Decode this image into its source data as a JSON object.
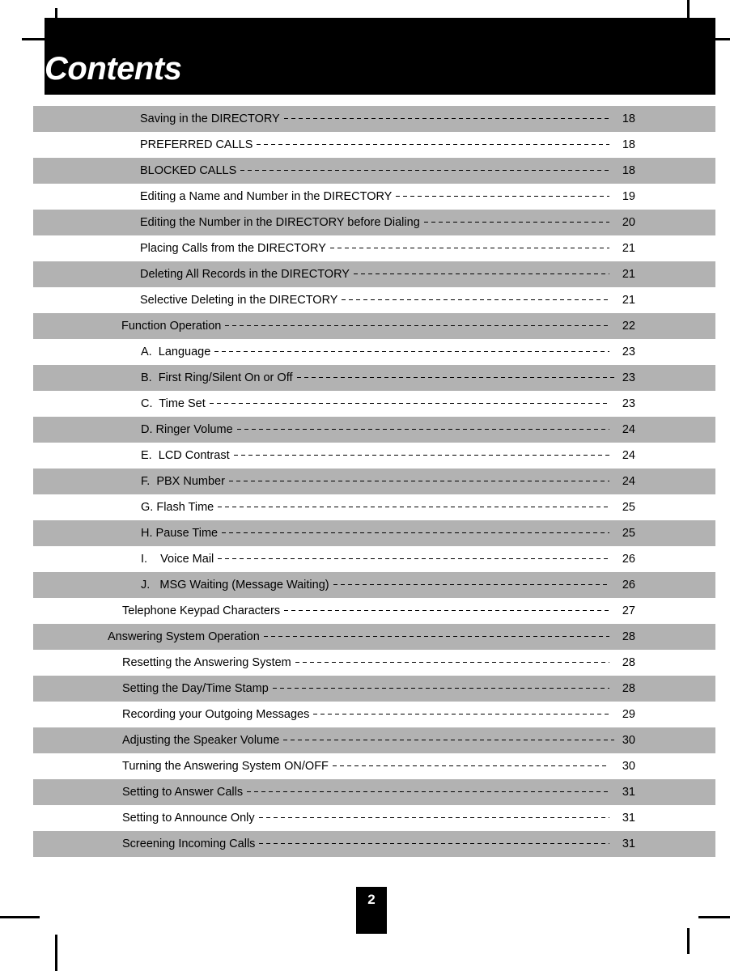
{
  "document": {
    "title": "Contents",
    "page_number": "2"
  },
  "toc": {
    "entries": [
      {
        "label": "Saving in the DIRECTORY",
        "page": "18",
        "indent": 3,
        "shaded": true,
        "tight": false
      },
      {
        "label": "PREFERRED CALLS",
        "page": "18",
        "indent": 3,
        "shaded": false,
        "tight": false
      },
      {
        "label": "BLOCKED CALLS",
        "page": "18",
        "indent": 3,
        "shaded": true,
        "tight": false
      },
      {
        "label": "Editing a Name and Number in the DIRECTORY",
        "page": "19",
        "indent": 3,
        "shaded": false,
        "tight": false
      },
      {
        "label": "Editing the Number in the DIRECTORY before Dialing",
        "page": "20",
        "indent": 3,
        "shaded": true,
        "tight": false
      },
      {
        "label": "Placing Calls from the DIRECTORY",
        "page": "21",
        "indent": 3,
        "shaded": false,
        "tight": false
      },
      {
        "label": "Deleting All Records in the DIRECTORY",
        "page": "21",
        "indent": 3,
        "shaded": true,
        "tight": false
      },
      {
        "label": "Selective Deleting in the DIRECTORY",
        "page": "21",
        "indent": 3,
        "shaded": false,
        "tight": false
      },
      {
        "label": "Function Operation",
        "page": "22",
        "indent": 1,
        "shaded": true,
        "tight": false
      },
      {
        "label": "A.  Language",
        "page": "23",
        "indent": 4,
        "shaded": false,
        "tight": false
      },
      {
        "label": "B.  First Ring/Silent On or Off",
        "page": "23",
        "indent": 4,
        "shaded": true,
        "tight": true
      },
      {
        "label": "C.  Time Set",
        "page": "23",
        "indent": 4,
        "shaded": false,
        "tight": false
      },
      {
        "label": "D. Ringer Volume",
        "page": "24",
        "indent": 4,
        "shaded": true,
        "tight": false
      },
      {
        "label": "E.  LCD Contrast",
        "page": "24",
        "indent": 4,
        "shaded": false,
        "tight": false
      },
      {
        "label": "F.  PBX Number",
        "page": "24",
        "indent": 4,
        "shaded": true,
        "tight": false
      },
      {
        "label": "G. Flash Time",
        "page": "25",
        "indent": 4,
        "shaded": false,
        "tight": false
      },
      {
        "label": "H. Pause Time",
        "page": "25",
        "indent": 4,
        "shaded": true,
        "tight": false
      },
      {
        "label": "I.    Voice Mail",
        "page": "26",
        "indent": 4,
        "shaded": false,
        "tight": false
      },
      {
        "label": "J.   MSG Waiting (Message Waiting)",
        "page": "26",
        "indent": 4,
        "shaded": true,
        "tight": false
      },
      {
        "label": "Telephone Keypad Characters",
        "page": "27",
        "indent": 2,
        "shaded": false,
        "tight": false
      },
      {
        "label": "Answering System Operation",
        "page": "28",
        "indent": 0,
        "shaded": true,
        "tight": false
      },
      {
        "label": "Resetting the Answering System",
        "page": "28",
        "indent": 2,
        "shaded": false,
        "tight": false
      },
      {
        "label": "Setting the Day/Time Stamp",
        "page": "28",
        "indent": 2,
        "shaded": true,
        "tight": false
      },
      {
        "label": "Recording your Outgoing Messages",
        "page": "29",
        "indent": 2,
        "shaded": false,
        "tight": false
      },
      {
        "label": "Adjusting the Speaker Volume",
        "page": "30",
        "indent": 2,
        "shaded": true,
        "tight": true
      },
      {
        "label": "Turning the Answering System ON/OFF",
        "page": "30",
        "indent": 2,
        "shaded": false,
        "tight": false
      },
      {
        "label": "Setting to Answer Calls",
        "page": "31",
        "indent": 2,
        "shaded": true,
        "tight": false
      },
      {
        "label": "Setting to Announce Only",
        "page": "31",
        "indent": 2,
        "shaded": false,
        "tight": false
      },
      {
        "label": "Screening Incoming Calls",
        "page": "31",
        "indent": 2,
        "shaded": true,
        "tight": false
      }
    ]
  },
  "colors": {
    "shade_row": "#b2b2b2",
    "banner": "#000000",
    "text": "#000000",
    "title_text": "#ffffff"
  }
}
